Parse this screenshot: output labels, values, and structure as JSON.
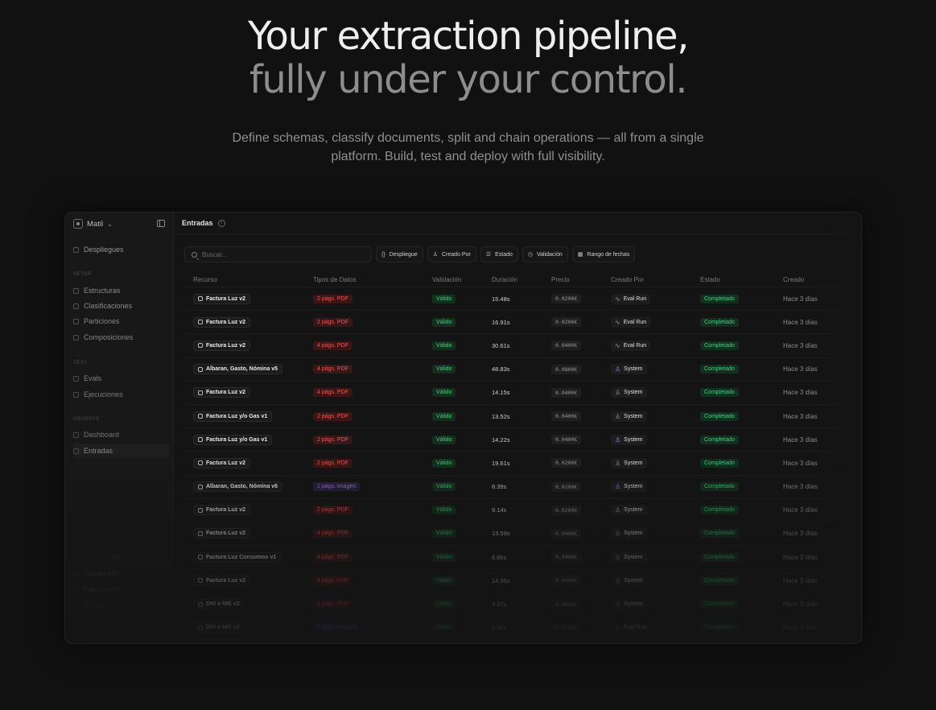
{
  "hero": {
    "line1": "Your extraction pipeline,",
    "line2": "fully under your control.",
    "subtitle": "Define schemas, classify documents, split and chain operations — all from a single platform. Build, test and deploy with full visibility."
  },
  "sidebar": {
    "org_name": "Matil",
    "org_icon": "org-logo-icon",
    "top_item": "Despliegues",
    "sections": [
      {
        "heading": "Setup",
        "items": [
          "Estructuras",
          "Clasificaciones",
          "Particiones",
          "Composiciones"
        ]
      },
      {
        "heading": "Test",
        "items": [
          "Evals",
          "Ejecuciones"
        ]
      },
      {
        "heading": "Observe",
        "items": [
          "Dashboard",
          "Entradas"
        ]
      },
      {
        "heading": "Configuración",
        "items": [
          "Claves API",
          "Facturación",
          "Equipo"
        ]
      }
    ],
    "active_item": "Entradas"
  },
  "page": {
    "title": "Entradas",
    "search_placeholder": "Buscar...",
    "filters": [
      "Despliegue",
      "Creado Por",
      "Estado",
      "Validación",
      "Rango de fechas"
    ]
  },
  "table": {
    "columns": [
      "Recurso",
      "Tipos de Datos",
      "Validación",
      "Duración",
      "Precio",
      "Creado Por",
      "Estado",
      "Creado"
    ],
    "rows": [
      {
        "recurso": "Factura Luz v2",
        "tipo": "2 págs. PDF",
        "tipo_kind": "pdf",
        "validacion": "Válido",
        "duracion": "15.48s",
        "precio": "0.0200€",
        "creado_por": "Eval Run",
        "creado_icon": "activity-icon",
        "estado": "Completado",
        "creado": "Hace 3 días"
      },
      {
        "recurso": "Factura Luz v2",
        "tipo": "2 págs. PDF",
        "tipo_kind": "pdf",
        "validacion": "Válido",
        "duracion": "16.91s",
        "precio": "0.0200€",
        "creado_por": "Eval Run",
        "creado_icon": "activity-icon",
        "estado": "Completado",
        "creado": "Hace 3 días"
      },
      {
        "recurso": "Factura Luz v2",
        "tipo": "4 págs. PDF",
        "tipo_kind": "pdf",
        "validacion": "Válido",
        "duracion": "30.61s",
        "precio": "0.0400€",
        "creado_por": "Eval Run",
        "creado_icon": "activity-icon",
        "estado": "Completado",
        "creado": "Hace 3 días"
      },
      {
        "recurso": "Albaran, Gasto, Nómina v5",
        "tipo": "4 págs. PDF",
        "tipo_kind": "pdf",
        "validacion": "Válido",
        "duracion": "48.83s",
        "precio": "0.0800€",
        "creado_por": "System",
        "creado_icon": "user-icon",
        "estado": "Completado",
        "creado": "Hace 3 días"
      },
      {
        "recurso": "Factura Luz v2",
        "tipo": "4 págs. PDF",
        "tipo_kind": "pdf",
        "validacion": "Válido",
        "duracion": "14.15s",
        "precio": "0.0400€",
        "creado_por": "System",
        "creado_icon": "user-icon",
        "estado": "Completado",
        "creado": "Hace 3 días"
      },
      {
        "recurso": "Factura Luz y/o Gas v1",
        "tipo": "2 págs. PDF",
        "tipo_kind": "pdf",
        "validacion": "Válido",
        "duracion": "13.52s",
        "precio": "0.0400€",
        "creado_por": "System",
        "creado_icon": "user-icon",
        "estado": "Completado",
        "creado": "Hace 3 días"
      },
      {
        "recurso": "Factura Luz y/o Gas v1",
        "tipo": "2 págs. PDF",
        "tipo_kind": "pdf",
        "validacion": "Válido",
        "duracion": "14.22s",
        "precio": "0.0400€",
        "creado_por": "System",
        "creado_icon": "user-icon",
        "estado": "Completado",
        "creado": "Hace 3 días"
      },
      {
        "recurso": "Factura Luz v2",
        "tipo": "2 págs. PDF",
        "tipo_kind": "pdf",
        "validacion": "Válido",
        "duracion": "19.61s",
        "precio": "0.0200€",
        "creado_por": "System",
        "creado_icon": "user-icon",
        "estado": "Completado",
        "creado": "Hace 3 días"
      },
      {
        "recurso": "Albaran, Gasto, Nómina v6",
        "tipo": "1 págs. Imagen",
        "tipo_kind": "img",
        "validacion": "Válido",
        "duracion": "8.39s",
        "precio": "0.0200€",
        "creado_por": "System",
        "creado_icon": "user-icon",
        "estado": "Completado",
        "creado": "Hace 3 días"
      },
      {
        "recurso": "Factura Luz v2",
        "tipo": "2 págs. PDF",
        "tipo_kind": "pdf",
        "validacion": "Válido",
        "duracion": "9.14s",
        "precio": "0.0200€",
        "creado_por": "System",
        "creado_icon": "user-icon",
        "estado": "Completado",
        "creado": "Hace 3 días"
      },
      {
        "recurso": "Factura Luz v2",
        "tipo": "4 págs. PDF",
        "tipo_kind": "pdf",
        "validacion": "Válido",
        "duracion": "13.59s",
        "precio": "0.0400€",
        "creado_por": "System",
        "creado_icon": "user-icon",
        "estado": "Completado",
        "creado": "Hace 3 días"
      },
      {
        "recurso": "Factura Luz Consumos v1",
        "tipo": "4 págs. PDF",
        "tipo_kind": "pdf",
        "validacion": "Válido",
        "duracion": "6.85s",
        "precio": "0.0400€",
        "creado_por": "System",
        "creado_icon": "user-icon",
        "estado": "Completado",
        "creado": "Hace 3 días"
      },
      {
        "recurso": "Factura Luz v2",
        "tipo": "4 págs. PDF",
        "tipo_kind": "pdf",
        "validacion": "Válido",
        "duracion": "14.36s",
        "precio": "0.0400€",
        "creado_por": "System",
        "creado_icon": "user-icon",
        "estado": "Completado",
        "creado": "Hace 3 días"
      },
      {
        "recurso": "DNI o NIE v2",
        "tipo": "4 págs. PDF",
        "tipo_kind": "pdf",
        "validacion": "Válido",
        "duracion": "3.37s",
        "precio": "0.0400€",
        "creado_por": "System",
        "creado_icon": "user-icon",
        "estado": "Completado",
        "creado": "Hace 3 días"
      },
      {
        "recurso": "DNI o NIE v2",
        "tipo": "1 págs. Imagen",
        "tipo_kind": "img",
        "validacion": "Válido",
        "duracion": "3.37s",
        "precio": "0.0100€",
        "creado_por": "Eval Run",
        "creado_icon": "activity-icon",
        "estado": "Completado",
        "creado": "Hace 3 días"
      }
    ]
  },
  "colors": {
    "background": "#111111",
    "accent_green": "#45d07a",
    "pdf_red": "#ee5a5a",
    "image_purple": "#9a79dd"
  }
}
